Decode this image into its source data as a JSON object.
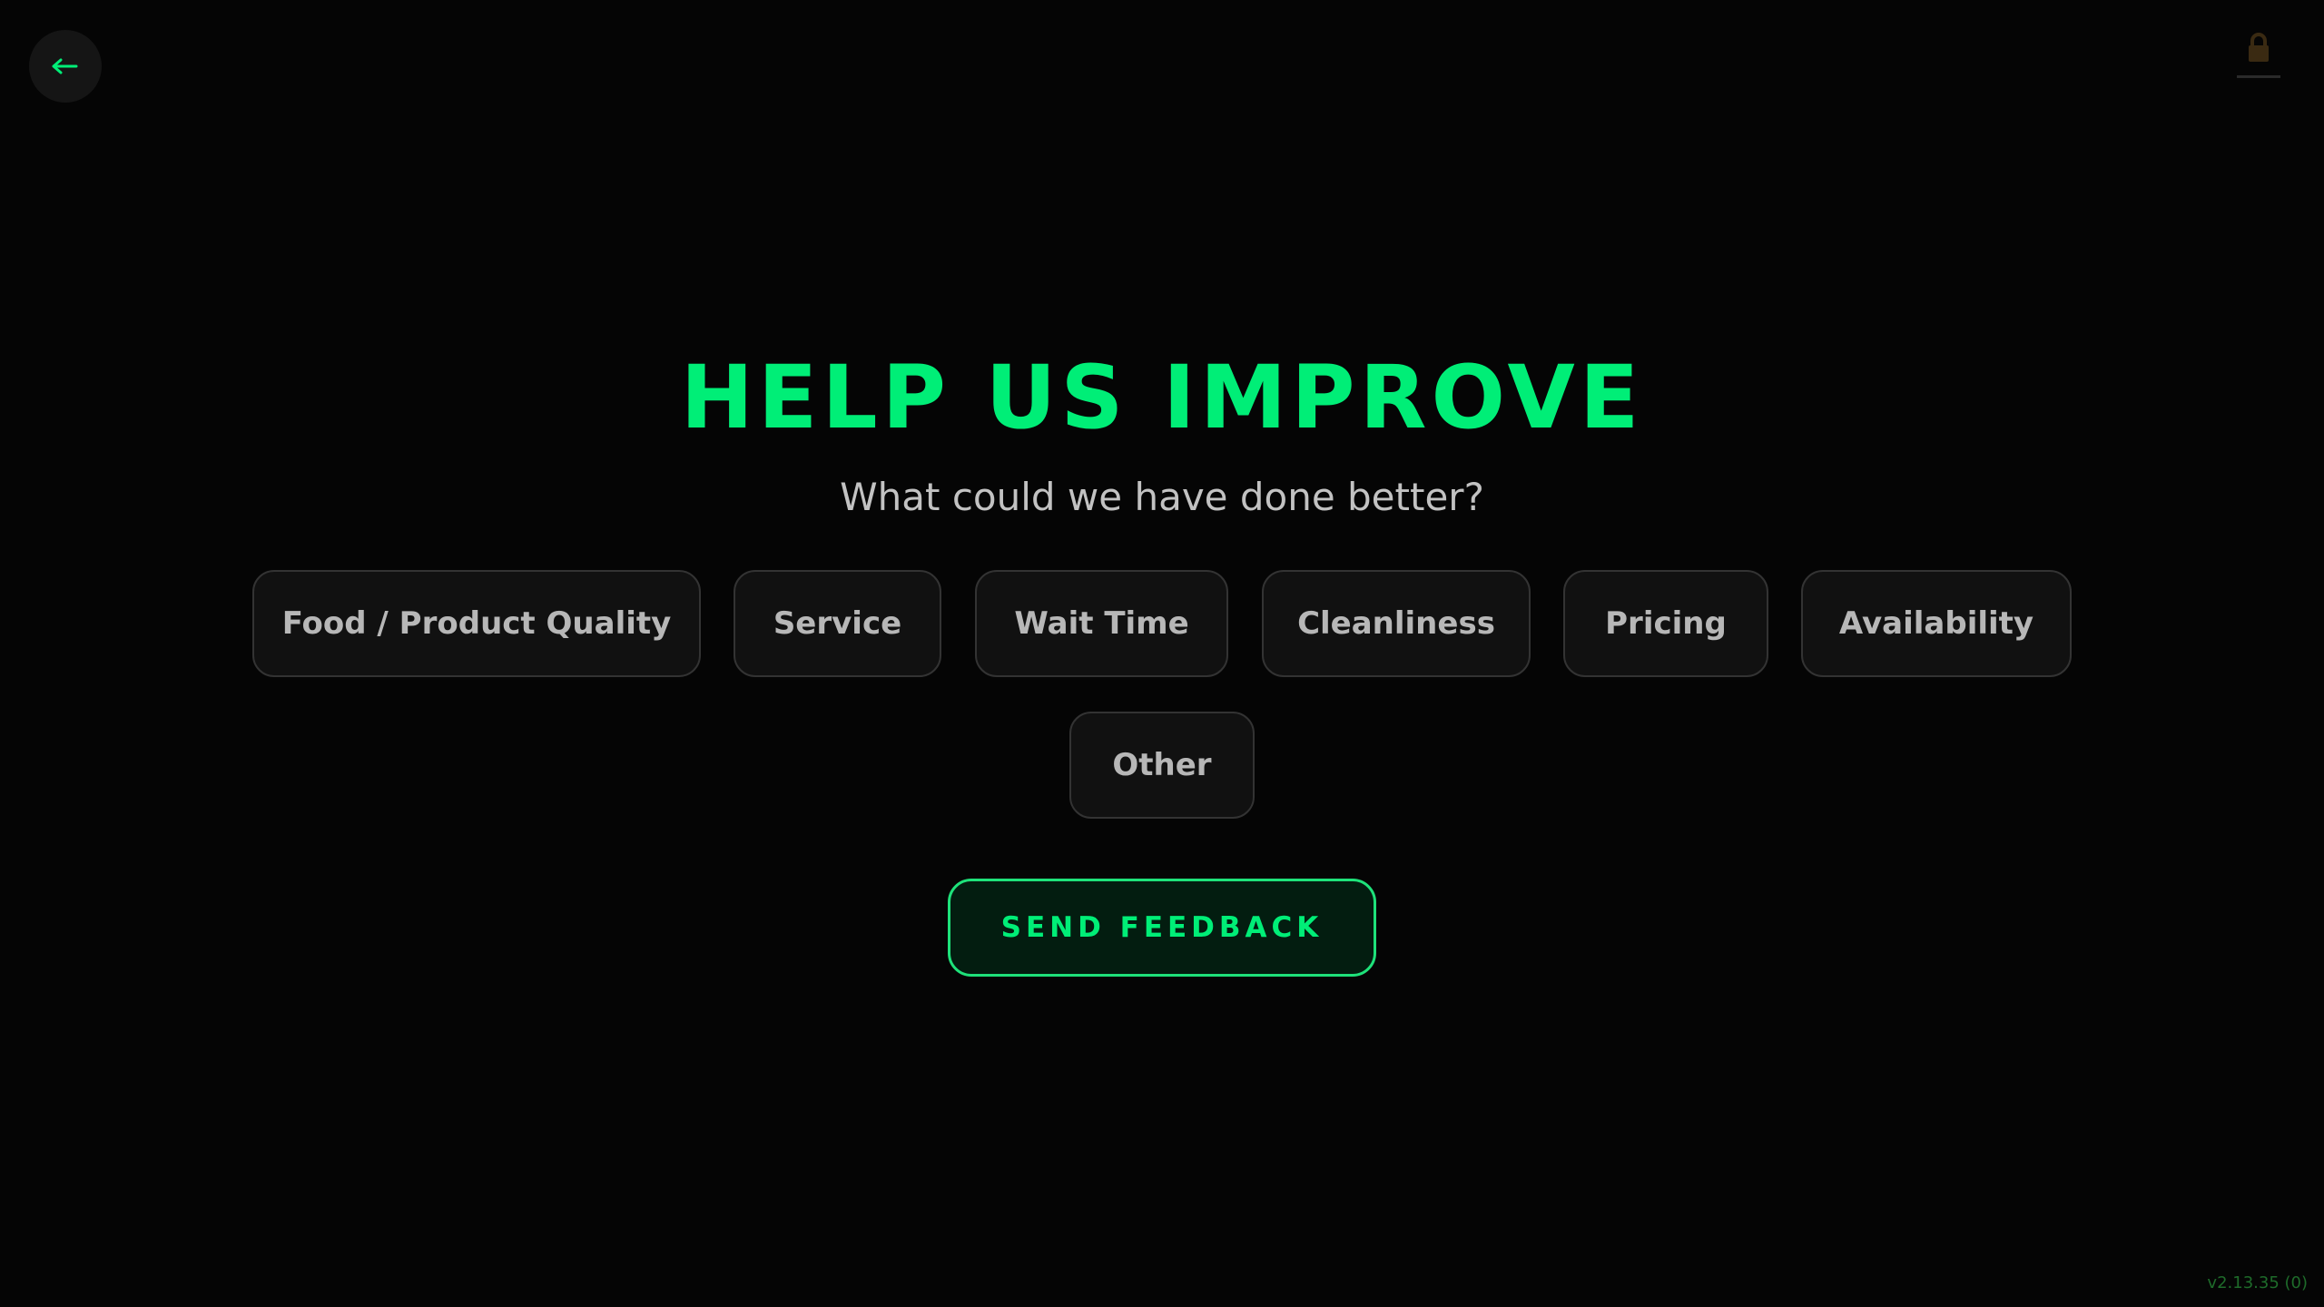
{
  "navigation": {
    "back_icon": "arrow-left-icon",
    "lock_icon": "lock-icon"
  },
  "header": {
    "title": "HELP US IMPROVE",
    "subtitle": "What could we have done better?"
  },
  "options": [
    {
      "label": "Food / Product Quality"
    },
    {
      "label": "Service"
    },
    {
      "label": "Wait Time"
    },
    {
      "label": "Cleanliness"
    },
    {
      "label": "Pricing"
    },
    {
      "label": "Availability"
    },
    {
      "label": "Other"
    }
  ],
  "actions": {
    "send_label": "SEND FEEDBACK"
  },
  "footer": {
    "version": "v2.13.35 (0)"
  },
  "colors": {
    "background": "#050505",
    "accent": "#00ee77",
    "button_dark": "#111111",
    "version_text": "#1e6b2a"
  }
}
